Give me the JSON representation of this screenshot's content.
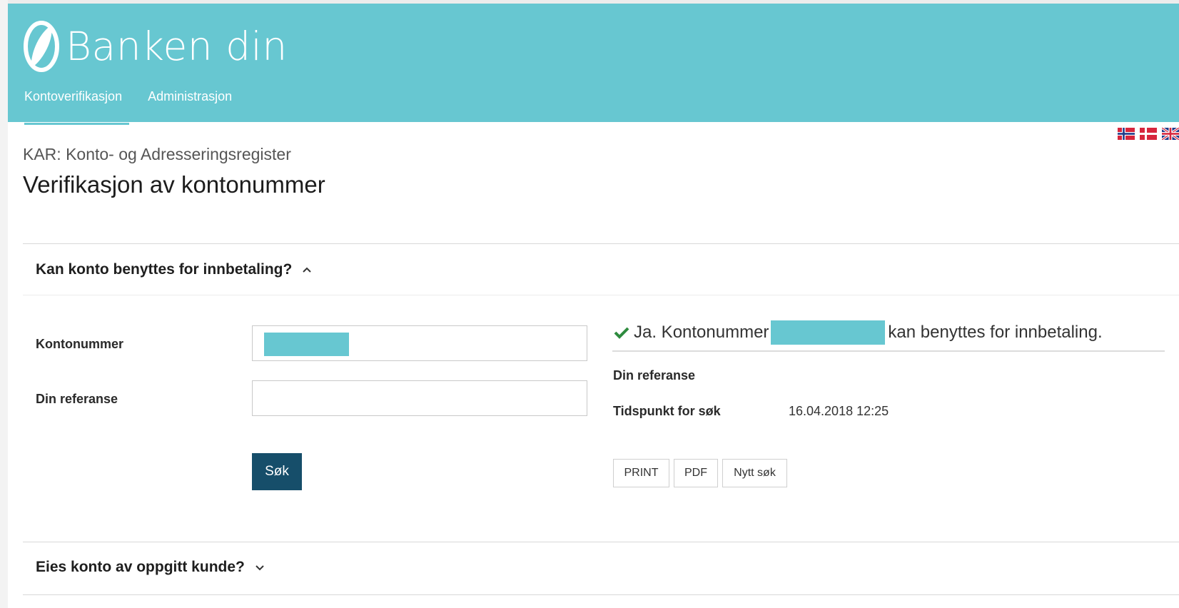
{
  "app": {
    "brand": "Banken din"
  },
  "nav": {
    "items": [
      {
        "label": "Kontoverifikasjon",
        "active": true
      },
      {
        "label": "Administrasjon",
        "active": false
      }
    ]
  },
  "languages": [
    "norwegian-flag-icon",
    "danish-flag-icon",
    "uk-flag-icon"
  ],
  "page": {
    "subtitle": "KAR: Konto- og Adresseringsregister",
    "title": "Verifikasjon av kontonummer"
  },
  "section1": {
    "title": "Kan konto benyttes for innbetaling?",
    "expanded": true,
    "form": {
      "account_label": "Kontonummer",
      "account_value": "",
      "reference_label": "Din referanse",
      "reference_value": "",
      "search_button": "Søk"
    },
    "result": {
      "prefix": "Ja. Kontonummer",
      "suffix": "kan benyttes for innbetaling.",
      "reference_label": "Din referanse",
      "reference_value": "",
      "time_label": "Tidspunkt for søk",
      "time_value": "16.04.2018 12:25",
      "buttons": {
        "print": "PRINT",
        "pdf": "PDF",
        "new_search": "Nytt søk"
      }
    }
  },
  "section2": {
    "title": "Eies konto av oppgitt kunde?",
    "expanded": false
  },
  "colors": {
    "brand": "#67c7d1",
    "primary_button": "#164e6a",
    "success": "#2e8b3e"
  }
}
